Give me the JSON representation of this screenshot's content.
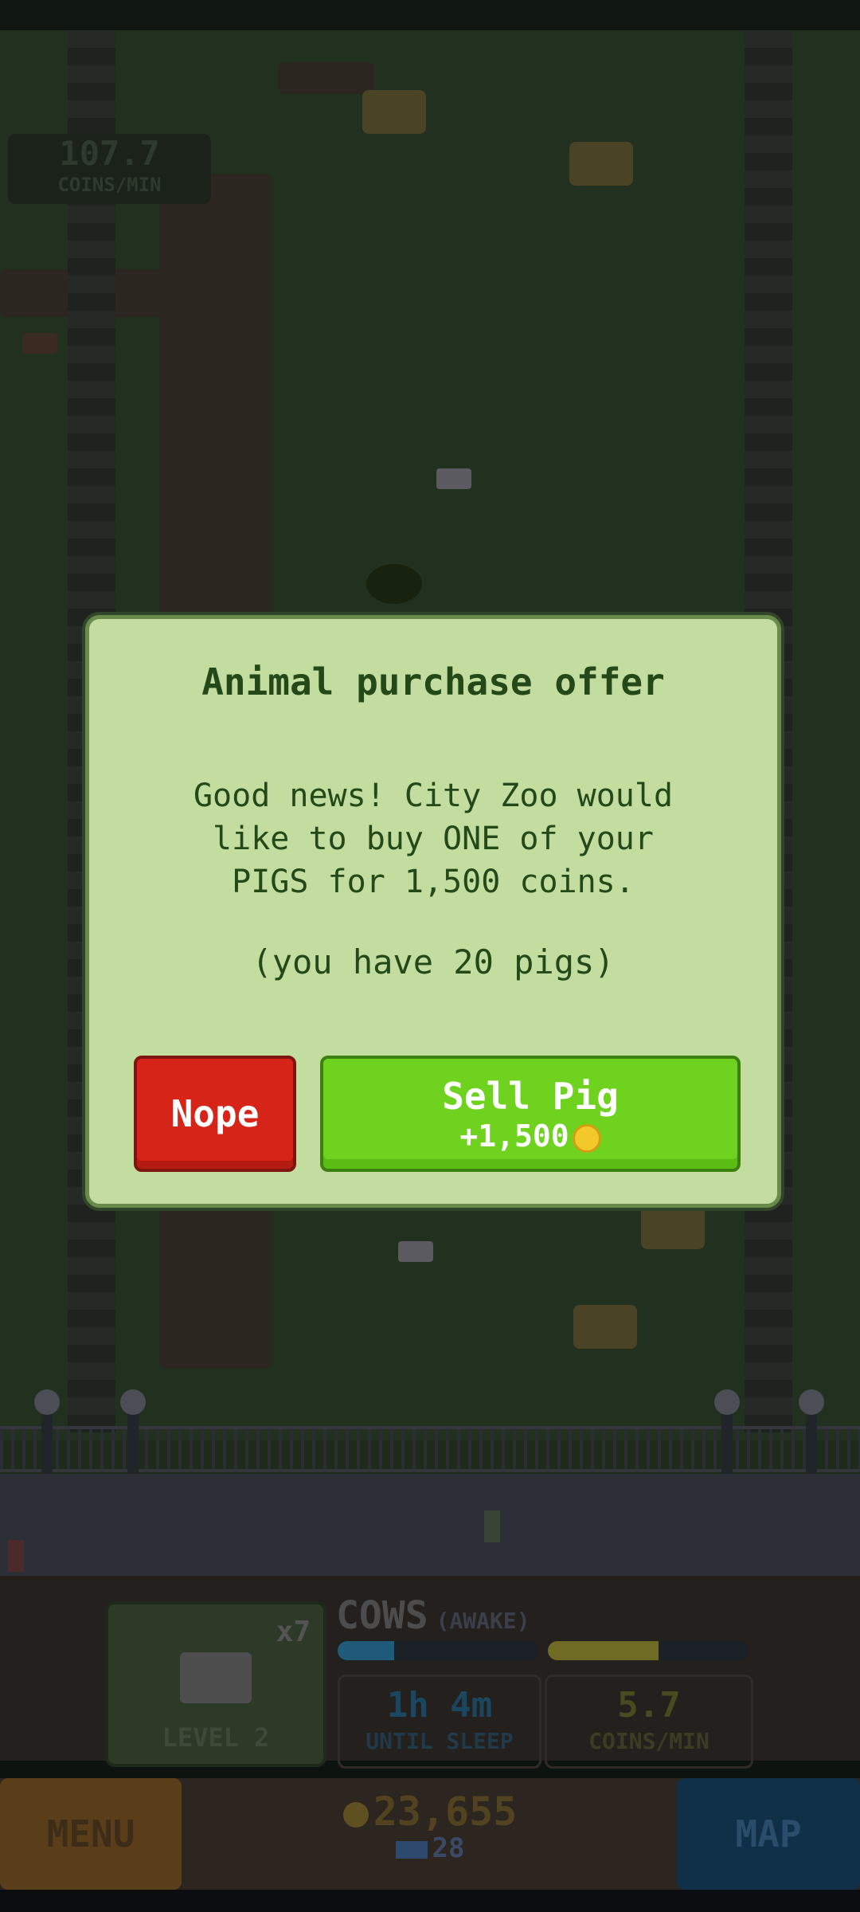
{
  "hud": {
    "rate_value": "107.7",
    "rate_label": "COINS/MIN"
  },
  "dialog": {
    "title": "Animal purchase offer",
    "body": "Good news! City Zoo would\nlike to buy ONE of your\nPIGS for 1,500 coins.",
    "subtext": "(you have 20 pigs)",
    "nope_label": "Nope",
    "sell_label": "Sell Pig",
    "sell_reward": "+1,500"
  },
  "animal_panel": {
    "count": "x7",
    "level": "LEVEL 2",
    "name": "COWS",
    "state": "(AWAKE)",
    "sleep_value": "1h 4m",
    "sleep_label": "UNTIL SLEEP",
    "rate_value": "5.7",
    "rate_label": "COINS/MIN",
    "awake_progress": 0.28,
    "coin_progress": 0.55,
    "colors": {
      "awake_bar": "#1f5a78",
      "coin_bar": "#6f6a24"
    }
  },
  "nav": {
    "menu_label": "MENU",
    "map_label": "MAP",
    "coins": "23,655",
    "gems": "28"
  }
}
